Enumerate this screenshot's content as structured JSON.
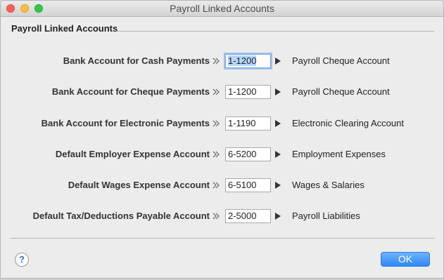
{
  "window": {
    "title": "Payroll Linked Accounts"
  },
  "group": {
    "label": "Payroll Linked Accounts"
  },
  "rows": [
    {
      "label": "Bank Account for Cash Payments",
      "value": "1-1200",
      "description": "Payroll Cheque Account",
      "focused": true
    },
    {
      "label": "Bank Account for Cheque Payments",
      "value": "1-1200",
      "description": "Payroll Cheque Account"
    },
    {
      "label": "Bank Account for Electronic Payments",
      "value": "1-1190",
      "description": "Electronic Clearing Account"
    },
    {
      "label": "Default Employer Expense Account",
      "value": "6-5200",
      "description": "Employment Expenses"
    },
    {
      "label": "Default Wages Expense Account",
      "value": "6-5100",
      "description": "Wages & Salaries"
    },
    {
      "label": "Default Tax/Deductions Payable Account",
      "value": "2-5000",
      "description": "Payroll Liabilities"
    }
  ],
  "buttons": {
    "help": "?",
    "ok": "OK"
  }
}
